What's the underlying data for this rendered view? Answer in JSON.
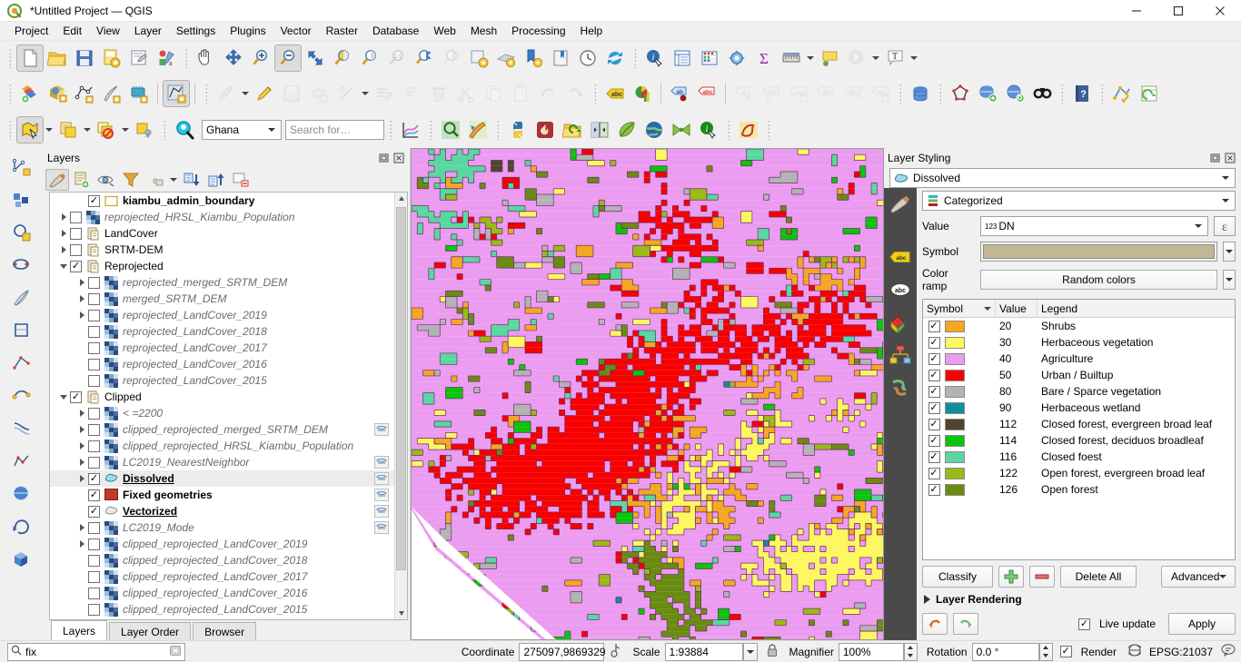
{
  "window": {
    "title": "*Untitled Project — QGIS",
    "app_icon": "qgis-logo-icon",
    "minimize": "–",
    "maximize": "▢",
    "close": "✕"
  },
  "menubar": {
    "items": [
      {
        "label": "Project",
        "accel": "P"
      },
      {
        "label": "Edit",
        "accel": "E"
      },
      {
        "label": "View",
        "accel": "V"
      },
      {
        "label": "Layer",
        "accel": "L"
      },
      {
        "label": "Settings",
        "accel": "S"
      },
      {
        "label": "Plugins",
        "accel": "P"
      },
      {
        "label": "Vector",
        "accel": "o"
      },
      {
        "label": "Raster",
        "accel": "R"
      },
      {
        "label": "Database",
        "accel": "D"
      },
      {
        "label": "Web",
        "accel": "W"
      },
      {
        "label": "Mesh",
        "accel": "M"
      },
      {
        "label": "Processing",
        "accel": "c"
      },
      {
        "label": "Help",
        "accel": "H"
      }
    ]
  },
  "toolbar_project": {
    "icons": [
      "new-project-icon",
      "open-project-icon",
      "save-project-icon",
      "save-project-as-icon",
      "new-print-layout-icon",
      "style-manager-icon"
    ]
  },
  "toolbar_map_nav": {
    "icons": [
      "pan-map-icon",
      "pan-to-selection-icon",
      "zoom-in-icon",
      "zoom-out-icon",
      "zoom-full-icon",
      "zoom-to-selection-icon",
      "zoom-to-layer-icon",
      "zoom-last-icon",
      "zoom-native-icon",
      "zoom-previous-icon",
      "zoom-next-icon",
      "new-map-view-icon",
      "new-3d-map-view-icon",
      "new-print-layout-icon2",
      "new-report-icon",
      "temporal-controller-icon",
      "refresh-icon"
    ]
  },
  "toolbar_attributes": {
    "icons": [
      "identify-features-icon",
      "open-attribute-table-icon",
      "field-calculator-icon",
      "processing-toolbox-icon",
      "statistical-summary-icon",
      "measure-line-icon",
      "map-tips-icon",
      "run-feature-action-icon",
      "text-annotation-icon"
    ]
  },
  "toolbar_datasource": {
    "icons": [
      "add-layer-icon",
      "add-wms-layer-icon",
      "add-vector-layer-icon",
      "add-delimited-text-icon",
      "add-mesh-layer-icon",
      "add-virtual-layer-icon",
      "toggle-editing-icon",
      "current-edits-icon",
      "save-layer-edits-icon",
      "add-feature-icon",
      "vertex-tool-icon",
      "modify-attributes-icon",
      "delete-selected-icon",
      "cut-features-icon",
      "copy-features-icon",
      "paste-features-icon",
      "undo-icon",
      "redo-icon"
    ]
  },
  "toolbar_labels": {
    "icons": [
      "layer-labeling-options-icon",
      "diagram-options-icon",
      "pin-labels-icon",
      "show-hide-labels-icon",
      "move-label-icon",
      "rotate-label-icon",
      "change-label-icon",
      "label-properties-icon",
      "highlight-pinned-labels-icon",
      "show-unplaced-labels-icon",
      "db-manager-icon",
      "digitize-shape-icon",
      "metasearch-icon",
      "qgis-cloud-icon",
      "geocoding-icon",
      "help-icon",
      "plugin-manager-icon",
      "refresh-attribute-icon"
    ]
  },
  "toolbar_selection": {
    "icons": [
      "select-features-icon",
      "select-by-expression-icon",
      "select-by-location-icon",
      "deselect-features-icon",
      "select-value-icon",
      "locator-search-icon"
    ],
    "region_value": "Ghana",
    "search_placeholder": "Search for…",
    "search_value": ""
  },
  "toolbar_plugins": {
    "icons": [
      "plot-icon",
      "zoom-search-icon",
      "paint-map-icon",
      "python-console-icon",
      "qgis-fire-icon",
      "open-data-icon",
      "swipe-tool-icon",
      "leaf-plugin-icon",
      "globe-plugin-icon",
      "green-plugin-icon",
      "info-plugin-icon",
      "profile-tool-icon"
    ]
  },
  "left_vertical_toolbar": {
    "icons": [
      "digitize-line-icon",
      "add-polygon-feature-icon",
      "add-circle-icon",
      "add-ellipse-icon",
      "feather-edit-icon",
      "trace-polygon-icon",
      "node-tool-icon",
      "reshape-features-icon",
      "offset-curve-icon",
      "simplify-feature-icon",
      "globe-tool-icon",
      "rotate-feature-icon",
      "3d-box-icon"
    ]
  },
  "layers_panel": {
    "title": "Layers",
    "dock_buttons": [
      "undock-icon",
      "close-icon"
    ],
    "toolbar_icons": [
      "open-layer-styling-panel-icon",
      "add-group-icon",
      "manage-map-themes-icon",
      "filter-legend-icon",
      "filter-legend-by-expression-icon",
      "expand-all-icon",
      "collapse-all-icon",
      "remove-layer-icon"
    ],
    "tabs": [
      {
        "label": "Layers",
        "selected": true
      },
      {
        "label": "Layer Order",
        "selected": false
      },
      {
        "label": "Browser",
        "selected": false
      }
    ],
    "tree": [
      {
        "label": "kiambu_admin_boundary",
        "indent": 1,
        "expander": "none",
        "checked": true,
        "icon": "polygon-outline-icon",
        "style": "bold"
      },
      {
        "label": "reprojected_HRSL_Kiambu_Population",
        "indent": 0,
        "expander": "closed",
        "checked": false,
        "icon": "raster-icon",
        "style": "italic"
      },
      {
        "label": "LandCover",
        "indent": 0,
        "expander": "closed",
        "checked": false,
        "icon": "group-icon",
        "style": "normal"
      },
      {
        "label": "SRTM-DEM",
        "indent": 0,
        "expander": "closed",
        "checked": false,
        "icon": "group-icon",
        "style": "normal"
      },
      {
        "label": "Reprojected",
        "indent": 0,
        "expander": "open",
        "checked": true,
        "icon": "group-icon",
        "style": "normal"
      },
      {
        "label": "reprojected_merged_SRTM_DEM",
        "indent": 1,
        "expander": "closed",
        "checked": false,
        "icon": "raster-icon",
        "style": "italic"
      },
      {
        "label": "merged_SRTM_DEM",
        "indent": 1,
        "expander": "closed",
        "checked": false,
        "icon": "raster-icon",
        "style": "italic"
      },
      {
        "label": "reprojected_LandCover_2019",
        "indent": 1,
        "expander": "closed",
        "checked": false,
        "icon": "raster-icon",
        "style": "italic"
      },
      {
        "label": "reprojected_LandCover_2018",
        "indent": 1,
        "expander": "none",
        "checked": false,
        "icon": "raster-icon",
        "style": "italic"
      },
      {
        "label": "reprojected_LandCover_2017",
        "indent": 1,
        "expander": "none",
        "checked": false,
        "icon": "raster-icon",
        "style": "italic"
      },
      {
        "label": "reprojected_LandCover_2016",
        "indent": 1,
        "expander": "none",
        "checked": false,
        "icon": "raster-icon",
        "style": "italic"
      },
      {
        "label": "reprojected_LandCover_2015",
        "indent": 1,
        "expander": "none",
        "checked": false,
        "icon": "raster-icon",
        "style": "italic"
      },
      {
        "label": "Clipped",
        "indent": 0,
        "expander": "open",
        "checked": true,
        "icon": "group-icon",
        "style": "normal"
      },
      {
        "label": "< =2200",
        "indent": 1,
        "expander": "closed",
        "checked": false,
        "icon": "raster-icon",
        "style": "italic"
      },
      {
        "label": "clipped_reprojected_merged_SRTM_DEM",
        "indent": 1,
        "expander": "closed",
        "checked": false,
        "icon": "raster-icon",
        "style": "italic",
        "edit": true
      },
      {
        "label": "clipped_reprojected_HRSL_Kiambu_Population",
        "indent": 1,
        "expander": "closed",
        "checked": false,
        "icon": "raster-icon",
        "style": "italic"
      },
      {
        "label": "LC2019_NearestNeighbor",
        "indent": 1,
        "expander": "closed",
        "checked": false,
        "icon": "raster-icon",
        "style": "italic",
        "edit": true
      },
      {
        "label": "Dissolved",
        "indent": 1,
        "expander": "closed",
        "checked": true,
        "icon": "polygon-blue-icon",
        "style": "bold-underline",
        "edit": true,
        "selected": true
      },
      {
        "label": "Fixed geometries",
        "indent": 1,
        "expander": "none",
        "checked": true,
        "icon": "polygon-red-icon",
        "style": "bold",
        "edit": true
      },
      {
        "label": "Vectorized",
        "indent": 1,
        "expander": "none",
        "checked": true,
        "icon": "polygon-gray-icon",
        "style": "bold-underline",
        "edit": true
      },
      {
        "label": "LC2019_Mode",
        "indent": 1,
        "expander": "closed",
        "checked": false,
        "icon": "raster-icon",
        "style": "italic",
        "edit": true
      },
      {
        "label": "clipped_reprojected_LandCover_2019",
        "indent": 1,
        "expander": "closed",
        "checked": false,
        "icon": "raster-icon",
        "style": "italic"
      },
      {
        "label": "clipped_reprojected_LandCover_2018",
        "indent": 1,
        "expander": "none",
        "checked": false,
        "icon": "raster-icon",
        "style": "italic"
      },
      {
        "label": "clipped_reprojected_LandCover_2017",
        "indent": 1,
        "expander": "none",
        "checked": false,
        "icon": "raster-icon",
        "style": "italic"
      },
      {
        "label": "clipped_reprojected_LandCover_2016",
        "indent": 1,
        "expander": "none",
        "checked": false,
        "icon": "raster-icon",
        "style": "italic"
      },
      {
        "label": "clipped_reprojected_LandCover_2015",
        "indent": 1,
        "expander": "none",
        "checked": false,
        "icon": "raster-icon",
        "style": "italic"
      }
    ]
  },
  "layer_styling": {
    "title": "Layer Styling",
    "dock_buttons": [
      "undock-icon",
      "close-icon"
    ],
    "layer_combo": "Dissolved",
    "renderer_combo": "Categorized",
    "side_icons": [
      "symbology-icon",
      "labels-icon",
      "masks-icon",
      "3d-view-icon",
      "diagrams-icon",
      "history-icon"
    ],
    "value_label": "Value",
    "value_field": "DN",
    "value_field_prefix": "123",
    "expression_button": "epsilon-expression-icon",
    "symbol_label": "Symbol",
    "symbol_color": "#c2b693",
    "colorramp_label": "Color ramp",
    "colorramp_value": "Random colors",
    "table": {
      "columns": [
        "Symbol",
        "Value",
        "Legend"
      ],
      "rows": [
        {
          "checked": true,
          "color": "#f5a623",
          "value": "20",
          "legend": "Shrubs"
        },
        {
          "checked": true,
          "color": "#fcf75e",
          "value": "30",
          "legend": "Herbaceous vegetation"
        },
        {
          "checked": true,
          "color": "#eb9cf0",
          "value": "40",
          "legend": "Agriculture"
        },
        {
          "checked": true,
          "color": "#f80000",
          "value": "50",
          "legend": "Urban / Builtup"
        },
        {
          "checked": true,
          "color": "#b3b3b3",
          "value": "80",
          "legend": "Bare / Sparce vegetation"
        },
        {
          "checked": true,
          "color": "#0f8e9e",
          "value": "90",
          "legend": "Herbaceous wetland"
        },
        {
          "checked": true,
          "color": "#50452b",
          "value": "112",
          "legend": "Closed forest, evergreen broad leaf"
        },
        {
          "checked": true,
          "color": "#0bc40b",
          "value": "114",
          "legend": "Closed forest, deciduos broadleaf"
        },
        {
          "checked": true,
          "color": "#59d7a0",
          "value": "116",
          "legend": "Closed foest"
        },
        {
          "checked": true,
          "color": "#9aba16",
          "value": "122",
          "legend": "Open forest, evergreen broad leaf"
        },
        {
          "checked": true,
          "color": "#6a8b12",
          "value": "126",
          "legend": "Open forest"
        }
      ]
    },
    "buttons": {
      "classify": "Classify",
      "add": "add-category-icon",
      "remove": "remove-category-icon",
      "delete_all": "Delete All",
      "advanced": "Advanced"
    },
    "layer_rendering": "Layer Rendering",
    "undo_icon": "undo-icon",
    "redo_icon": "redo-icon",
    "live_update_label": "Live update",
    "live_update_checked": true,
    "apply": "Apply"
  },
  "statusbar": {
    "locator_icon": "search-icon",
    "locator_value": "fix",
    "locator_clear": "clear-icon",
    "coordinate_label": "Coordinate",
    "coordinate_value": "275097,9869329",
    "toggle_extents_icon": "toggle-extents-icon",
    "scale_label": "Scale",
    "scale_value": "1:93884",
    "lock_icon": "lock-scale-icon",
    "magnifier_label": "Magnifier",
    "magnifier_value": "100%",
    "rotation_label": "Rotation",
    "rotation_value": "0.0 °",
    "render_label": "Render",
    "render_checked": true,
    "crs_icon": "crs-globe-icon",
    "crs_label": "EPSG:21037",
    "messages_icon": "messages-icon"
  },
  "map": {
    "background": "#ffffff",
    "colors": {
      "agriculture": "#eb9cf0",
      "urban": "#f80000",
      "herbaceous": "#fcf75e",
      "shrubs": "#f5a623",
      "bare": "#b3b3b3",
      "wetland": "#0f8e9e",
      "closed_forest_evergreen": "#50452b",
      "closed_forest_decid": "#0bc40b",
      "closed_forest": "#59d7a0",
      "open_forest_evergreen": "#9aba16",
      "open_forest": "#6a8b12",
      "outline": "#6b2d6b"
    }
  }
}
